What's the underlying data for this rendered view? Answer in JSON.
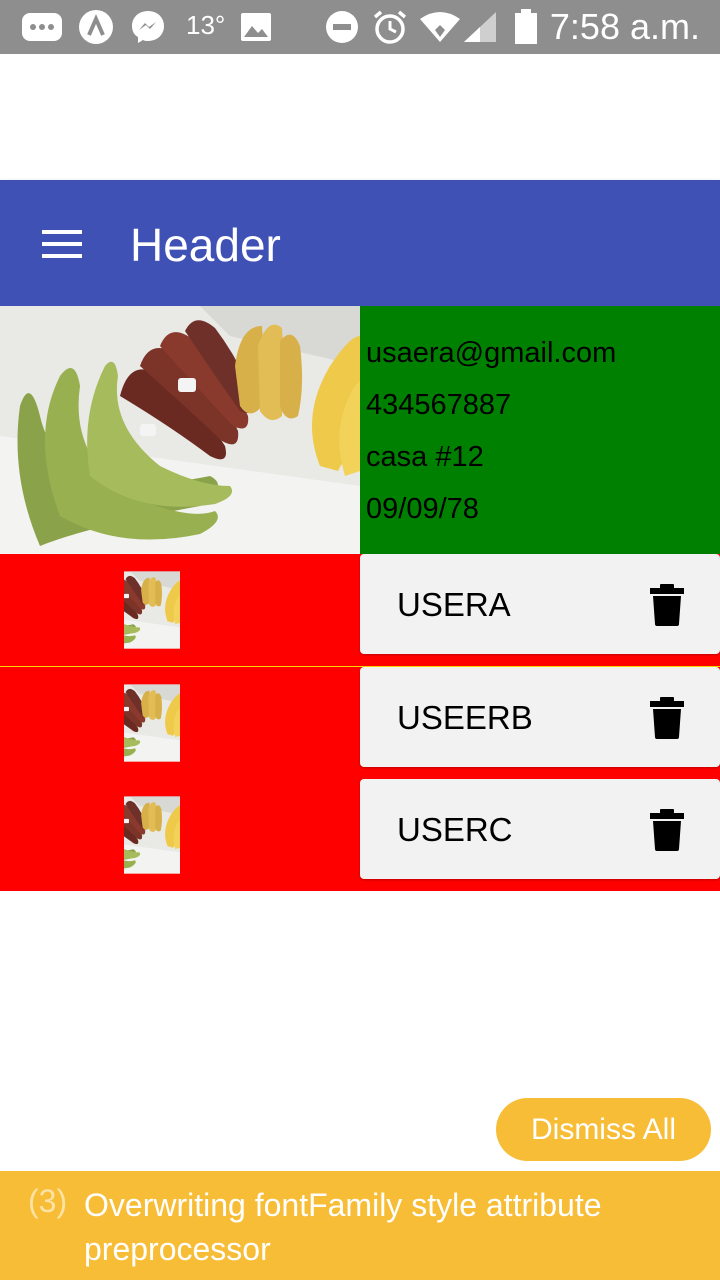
{
  "status_bar": {
    "temperature": "13°",
    "time": "7:58 a.m.",
    "icons": [
      "more-icon",
      "app-icon",
      "messenger-icon",
      "gallery-icon",
      "do-not-disturb-icon",
      "alarm-icon",
      "wifi-icon",
      "signal-icon",
      "battery-icon"
    ]
  },
  "header": {
    "title": "Header",
    "menu_icon": "menu-icon"
  },
  "profile": {
    "email": "usaera@gmail.com",
    "phone": "434567887",
    "address": "casa #12",
    "birthdate": "09/09/78",
    "info_bg": "#008000"
  },
  "users": [
    {
      "name": "USERA"
    },
    {
      "name": "USEERB"
    },
    {
      "name": "USERC"
    }
  ],
  "row_bg": "#ff0000",
  "toast": {
    "dismiss_label": "Dismiss All",
    "count": "(3)",
    "message": "Overwriting fontFamily style attribute preprocessor",
    "bg": "#f8bd37"
  }
}
